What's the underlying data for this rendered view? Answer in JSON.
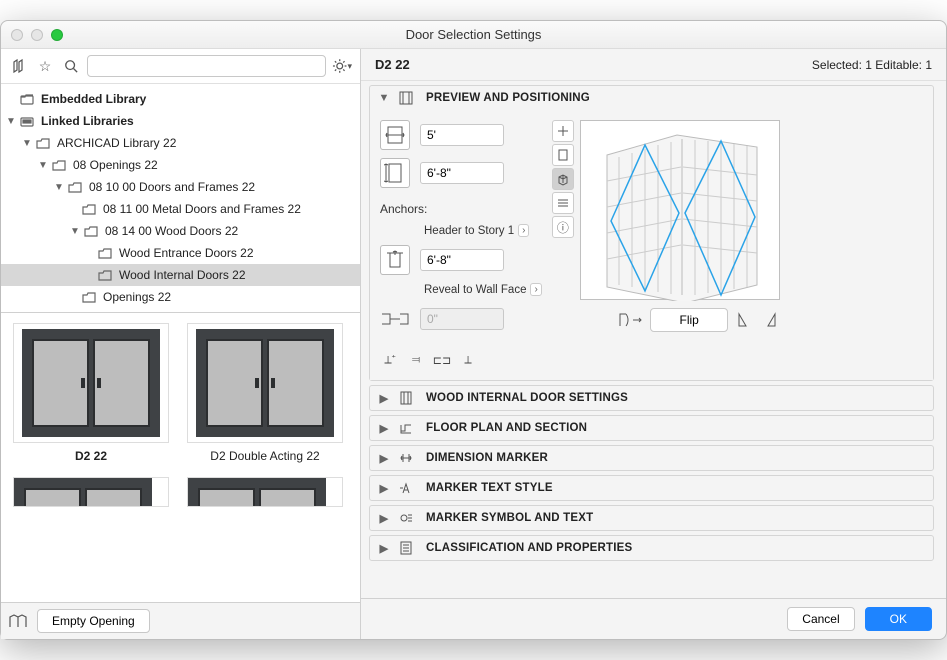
{
  "window": {
    "title": "Door Selection Settings"
  },
  "header": {
    "name": "D2 22",
    "selected": "Selected: 1 Editable: 1"
  },
  "search": {
    "placeholder": ""
  },
  "tree": {
    "embedded": "Embedded Library",
    "linked": "Linked Libraries",
    "archicad": "ARCHICAD Library 22",
    "openings": "08 Openings 22",
    "doors_frames": "08 10 00 Doors and Frames 22",
    "metal_doors": "08 11 00 Metal Doors and Frames 22",
    "wood_doors": "08 14 00 Wood Doors 22",
    "wood_entrance": "Wood Entrance Doors 22",
    "wood_internal": "Wood Internal Doors 22",
    "openings2": "Openings 22"
  },
  "thumbs": {
    "d2": "D2 22",
    "d2da": "D2 Double Acting 22"
  },
  "leftFooter": {
    "empty": "Empty Opening"
  },
  "panels": {
    "preview": "PREVIEW AND POSITIONING",
    "wood": "WOOD INTERNAL DOOR SETTINGS",
    "floor": "FLOOR PLAN AND SECTION",
    "dim": "DIMENSION MARKER",
    "mts": "MARKER TEXT STYLE",
    "mst": "MARKER SYMBOL AND TEXT",
    "cls": "CLASSIFICATION AND PROPERTIES"
  },
  "dims": {
    "width": "5'",
    "height": "6'-8\"",
    "anchors": "Anchors:",
    "headerStory": "Header to Story 1",
    "headerVal": "6'-8\"",
    "revealWall": "Reveal to Wall Face",
    "revealVal": "0\"",
    "flip": "Flip"
  },
  "footer": {
    "cancel": "Cancel",
    "ok": "OK"
  }
}
